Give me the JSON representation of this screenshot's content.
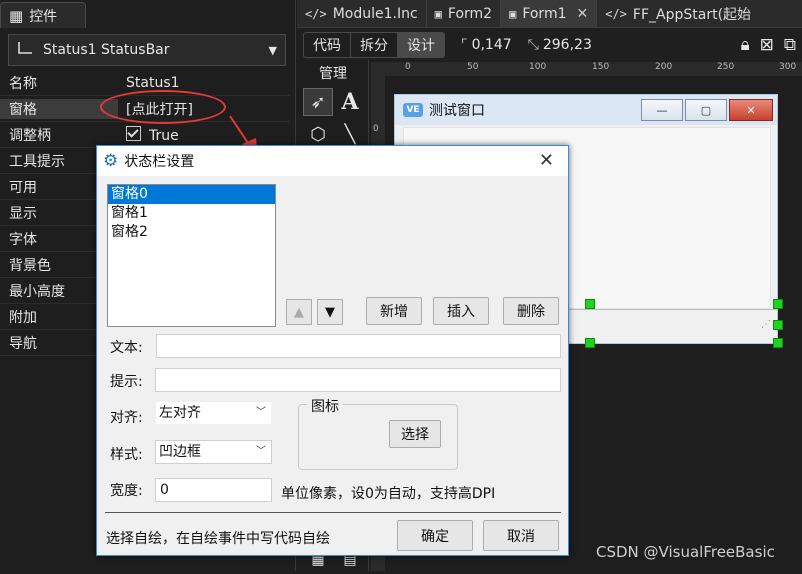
{
  "left_panel": {
    "tab_label": "控件",
    "control_select": "Status1   StatusBar",
    "properties": [
      {
        "name": "名称",
        "value": "Status1"
      },
      {
        "name": "窗格",
        "value": "[点此打开]"
      },
      {
        "name": "调整柄",
        "value": "True"
      },
      {
        "name": "工具提示",
        "value": ""
      },
      {
        "name": "可用",
        "value": ""
      },
      {
        "name": "显示",
        "value": ""
      },
      {
        "name": "字体",
        "value": ""
      },
      {
        "name": "背景色",
        "value": ""
      },
      {
        "name": "最小高度",
        "value": ""
      },
      {
        "name": "附加",
        "value": ""
      },
      {
        "name": "导航",
        "value": ""
      }
    ]
  },
  "doc_tabs": [
    {
      "label": "Module1.Inc",
      "icon": "code-icon"
    },
    {
      "label": "Form2",
      "icon": "form-icon"
    },
    {
      "label": "Form1",
      "icon": "form-icon",
      "active": true
    },
    {
      "label": "FF_AppStart(起始",
      "icon": "code-icon"
    }
  ],
  "toolbar": {
    "view_buttons": [
      "代码",
      "拆分",
      "设计"
    ],
    "position": "0,147",
    "size": "296,23"
  },
  "manage": {
    "label": "管理"
  },
  "ruler": {
    "top_ticks": [
      "0",
      "50",
      "100",
      "150",
      "200",
      "250",
      "300"
    ],
    "left_ticks": [
      "0"
    ]
  },
  "design_form": {
    "title": "测试窗口",
    "logo": "VE"
  },
  "dialog": {
    "title": "状态栏设置",
    "panes": [
      "窗格0",
      "窗格1",
      "窗格2"
    ],
    "buttons": {
      "add": "新增",
      "insert": "插入",
      "delete": "删除",
      "select": "选择",
      "ok": "确定",
      "cancel": "取消"
    },
    "labels": {
      "text": "文本:",
      "tip": "提示:",
      "align": "对齐:",
      "style": "样式:",
      "width": "宽度:",
      "icon_group": "图标"
    },
    "fields": {
      "text": "",
      "tip": "",
      "width": "0"
    },
    "combos": {
      "align": "左对齐",
      "style": "凹边框"
    },
    "width_hint": "单位像素，设0为自动，支持高DPI",
    "footer_note": "选择自绘，在自绘事件中写代码自绘"
  },
  "watermark": "CSDN @VisualFreeBasic",
  "colors": {
    "selection": "#0078d7",
    "annotation": "#e53935",
    "handle": "#1ed41e"
  }
}
